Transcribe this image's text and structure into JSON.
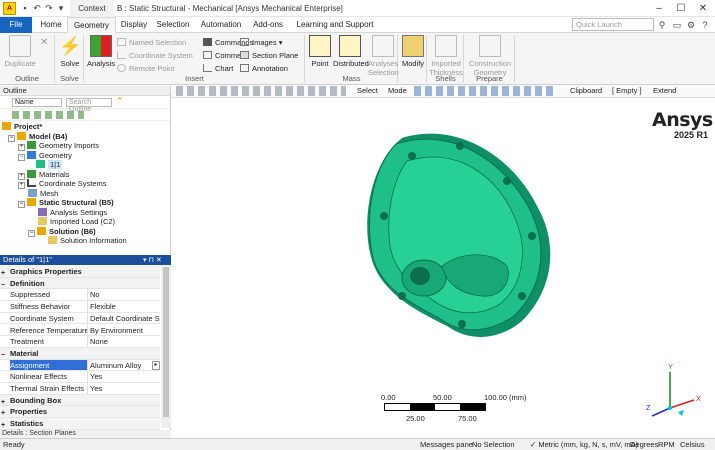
{
  "titlebar": {
    "context_tab": "Context",
    "title": "B : Static Structural - Mechanical [Ansys Mechanical Enterprise]"
  },
  "tabs": [
    "File",
    "Home",
    "Geometry",
    "Display",
    "Selection",
    "Automation",
    "Add-ons",
    "Learning and Support"
  ],
  "search": {
    "placeholder": "Quick Launch"
  },
  "ribbon": {
    "outline": {
      "duplicate": "Duplicate",
      "label": "Outline"
    },
    "solve": {
      "solve": "Solve",
      "label": "Solve"
    },
    "insert": {
      "analysis": "Analysis",
      "named_selection": "Named Selection",
      "coordinate_system": "Coordinate System",
      "remote_point": "Remote Point",
      "commands": "Commands",
      "comment": "Comment",
      "chart": "Chart",
      "images": "Images",
      "section_plane": "Section Plane",
      "annotation": "Annotation",
      "label": "Insert"
    },
    "mass": {
      "point": "Point",
      "distributed": "Distributed",
      "analyses_selection": "Analyses Selection",
      "label": "Mass"
    },
    "modify": {
      "modify": "Modify"
    },
    "shells": {
      "imported_thickness": "Imported Thickness",
      "label": "Shells"
    },
    "prepare": {
      "construction_geometry": "Construction Geometry",
      "label": "Prepare"
    }
  },
  "toolbar": {
    "select": "Select",
    "mode": "Mode",
    "clipboard": "Clipboard",
    "empty": "[ Empty ]",
    "extend": "Extend"
  },
  "outline": {
    "title": "Outline",
    "name_filter": "Name",
    "search_placeholder": "Search Outline",
    "tree": [
      "Project*",
      "Model (B4)",
      "Geometry Imports",
      "Geometry",
      "1|1",
      "Materials",
      "Coordinate Systems",
      "Mesh",
      "Static Structural (B5)",
      "Analysis Settings",
      "Imported Load (C2)",
      "Solution (B6)",
      "Solution Information"
    ]
  },
  "details": {
    "title": "Details of \"1|1\"",
    "rows": [
      {
        "k": "Graphics Properties",
        "v": ""
      },
      {
        "k": "Definition",
        "v": ""
      },
      {
        "k": "Suppressed",
        "v": "No"
      },
      {
        "k": "Stiffness Behavior",
        "v": "Flexible"
      },
      {
        "k": "Coordinate System",
        "v": "Default Coordinate S..."
      },
      {
        "k": "Reference Temperature",
        "v": "By Environment"
      },
      {
        "k": "Treatment",
        "v": "None"
      },
      {
        "k": "Material",
        "v": ""
      },
      {
        "k": "Assignment",
        "v": "Aluminum Alloy"
      },
      {
        "k": "Nonlinear Effects",
        "v": "Yes"
      },
      {
        "k": "Thermal Strain Effects",
        "v": "Yes"
      },
      {
        "k": "Bounding Box",
        "v": ""
      },
      {
        "k": "Properties",
        "v": ""
      },
      {
        "k": "Statistics",
        "v": ""
      }
    ],
    "footer": "Details : Section Planes"
  },
  "viewport": {
    "brand": "Ansys",
    "version": "2025 R1",
    "scale": [
      "0.00",
      "50.00",
      "100.00 (mm)",
      "25.00",
      "75.00"
    ],
    "axes": [
      "X",
      "Y",
      "Z"
    ]
  },
  "status": {
    "ready": "Ready",
    "messages": "Messages pane",
    "selection": "No Selection",
    "units": "Metric (mm, kg, N, s, mV, mA)",
    "degrees": "Degrees",
    "rpm": "RPM",
    "celsius": "Celsius"
  },
  "colors": {
    "part": "#1fbf8a",
    "accent": "#1565c0"
  }
}
